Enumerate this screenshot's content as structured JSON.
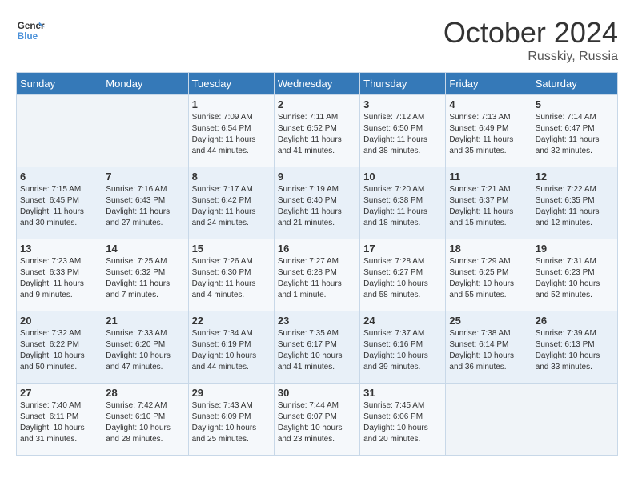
{
  "header": {
    "logo_line1": "General",
    "logo_line2": "Blue",
    "month": "October 2024",
    "location": "Russkiy, Russia"
  },
  "weekdays": [
    "Sunday",
    "Monday",
    "Tuesday",
    "Wednesday",
    "Thursday",
    "Friday",
    "Saturday"
  ],
  "weeks": [
    [
      {
        "day": "",
        "info": ""
      },
      {
        "day": "",
        "info": ""
      },
      {
        "day": "1",
        "info": "Sunrise: 7:09 AM\nSunset: 6:54 PM\nDaylight: 11 hours and 44 minutes."
      },
      {
        "day": "2",
        "info": "Sunrise: 7:11 AM\nSunset: 6:52 PM\nDaylight: 11 hours and 41 minutes."
      },
      {
        "day": "3",
        "info": "Sunrise: 7:12 AM\nSunset: 6:50 PM\nDaylight: 11 hours and 38 minutes."
      },
      {
        "day": "4",
        "info": "Sunrise: 7:13 AM\nSunset: 6:49 PM\nDaylight: 11 hours and 35 minutes."
      },
      {
        "day": "5",
        "info": "Sunrise: 7:14 AM\nSunset: 6:47 PM\nDaylight: 11 hours and 32 minutes."
      }
    ],
    [
      {
        "day": "6",
        "info": "Sunrise: 7:15 AM\nSunset: 6:45 PM\nDaylight: 11 hours and 30 minutes."
      },
      {
        "day": "7",
        "info": "Sunrise: 7:16 AM\nSunset: 6:43 PM\nDaylight: 11 hours and 27 minutes."
      },
      {
        "day": "8",
        "info": "Sunrise: 7:17 AM\nSunset: 6:42 PM\nDaylight: 11 hours and 24 minutes."
      },
      {
        "day": "9",
        "info": "Sunrise: 7:19 AM\nSunset: 6:40 PM\nDaylight: 11 hours and 21 minutes."
      },
      {
        "day": "10",
        "info": "Sunrise: 7:20 AM\nSunset: 6:38 PM\nDaylight: 11 hours and 18 minutes."
      },
      {
        "day": "11",
        "info": "Sunrise: 7:21 AM\nSunset: 6:37 PM\nDaylight: 11 hours and 15 minutes."
      },
      {
        "day": "12",
        "info": "Sunrise: 7:22 AM\nSunset: 6:35 PM\nDaylight: 11 hours and 12 minutes."
      }
    ],
    [
      {
        "day": "13",
        "info": "Sunrise: 7:23 AM\nSunset: 6:33 PM\nDaylight: 11 hours and 9 minutes."
      },
      {
        "day": "14",
        "info": "Sunrise: 7:25 AM\nSunset: 6:32 PM\nDaylight: 11 hours and 7 minutes."
      },
      {
        "day": "15",
        "info": "Sunrise: 7:26 AM\nSunset: 6:30 PM\nDaylight: 11 hours and 4 minutes."
      },
      {
        "day": "16",
        "info": "Sunrise: 7:27 AM\nSunset: 6:28 PM\nDaylight: 11 hours and 1 minute."
      },
      {
        "day": "17",
        "info": "Sunrise: 7:28 AM\nSunset: 6:27 PM\nDaylight: 10 hours and 58 minutes."
      },
      {
        "day": "18",
        "info": "Sunrise: 7:29 AM\nSunset: 6:25 PM\nDaylight: 10 hours and 55 minutes."
      },
      {
        "day": "19",
        "info": "Sunrise: 7:31 AM\nSunset: 6:23 PM\nDaylight: 10 hours and 52 minutes."
      }
    ],
    [
      {
        "day": "20",
        "info": "Sunrise: 7:32 AM\nSunset: 6:22 PM\nDaylight: 10 hours and 50 minutes."
      },
      {
        "day": "21",
        "info": "Sunrise: 7:33 AM\nSunset: 6:20 PM\nDaylight: 10 hours and 47 minutes."
      },
      {
        "day": "22",
        "info": "Sunrise: 7:34 AM\nSunset: 6:19 PM\nDaylight: 10 hours and 44 minutes."
      },
      {
        "day": "23",
        "info": "Sunrise: 7:35 AM\nSunset: 6:17 PM\nDaylight: 10 hours and 41 minutes."
      },
      {
        "day": "24",
        "info": "Sunrise: 7:37 AM\nSunset: 6:16 PM\nDaylight: 10 hours and 39 minutes."
      },
      {
        "day": "25",
        "info": "Sunrise: 7:38 AM\nSunset: 6:14 PM\nDaylight: 10 hours and 36 minutes."
      },
      {
        "day": "26",
        "info": "Sunrise: 7:39 AM\nSunset: 6:13 PM\nDaylight: 10 hours and 33 minutes."
      }
    ],
    [
      {
        "day": "27",
        "info": "Sunrise: 7:40 AM\nSunset: 6:11 PM\nDaylight: 10 hours and 31 minutes."
      },
      {
        "day": "28",
        "info": "Sunrise: 7:42 AM\nSunset: 6:10 PM\nDaylight: 10 hours and 28 minutes."
      },
      {
        "day": "29",
        "info": "Sunrise: 7:43 AM\nSunset: 6:09 PM\nDaylight: 10 hours and 25 minutes."
      },
      {
        "day": "30",
        "info": "Sunrise: 7:44 AM\nSunset: 6:07 PM\nDaylight: 10 hours and 23 minutes."
      },
      {
        "day": "31",
        "info": "Sunrise: 7:45 AM\nSunset: 6:06 PM\nDaylight: 10 hours and 20 minutes."
      },
      {
        "day": "",
        "info": ""
      },
      {
        "day": "",
        "info": ""
      }
    ]
  ]
}
